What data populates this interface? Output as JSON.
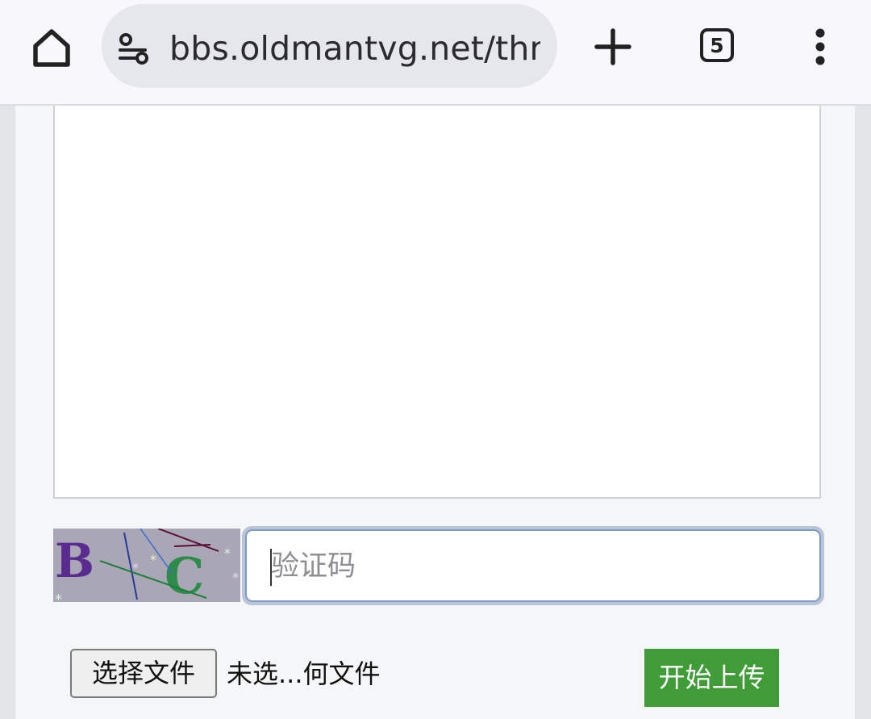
{
  "browser": {
    "url": "bbs.oldmantvg.net/thread",
    "tab_count": "5",
    "icons": {
      "home": "home-icon",
      "site_info": "tune-icon",
      "new_tab": "plus-icon",
      "tabs": "tab-switcher-icon",
      "menu": "more-vert-icon"
    }
  },
  "form": {
    "captcha": {
      "image_text": "B C",
      "placeholder": "验证码",
      "value": ""
    },
    "file": {
      "choose_label": "选择文件",
      "status": "未选...何文件"
    },
    "upload_label": "开始上传"
  },
  "colors": {
    "upload_button": "#3f9c37",
    "captcha_bg": "#a9a6b6"
  }
}
